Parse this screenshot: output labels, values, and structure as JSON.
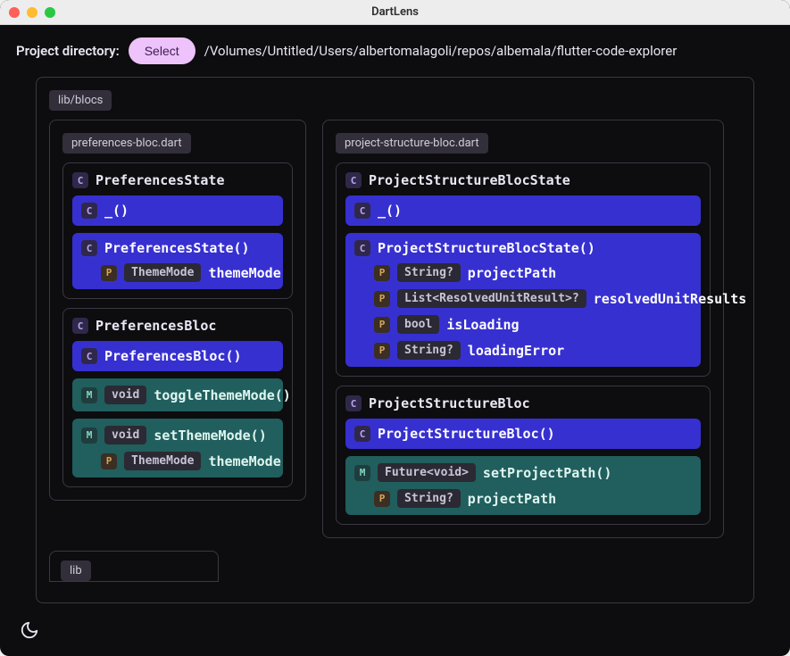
{
  "window": {
    "title": "DartLens"
  },
  "toolbar": {
    "label": "Project directory:",
    "select_label": "Select",
    "path": "/Volumes/Untitled/Users/albertomalagoli/repos/albemala/flutter-code-explorer"
  },
  "badges": {
    "c": "C",
    "m": "M",
    "p": "P"
  },
  "folders": [
    {
      "name": "lib/blocs"
    },
    {
      "name": "lib"
    }
  ],
  "files": [
    {
      "name": "preferences-bloc.dart",
      "classes": [
        {
          "name": "PreferencesState",
          "ctors": [
            {
              "name": "_()",
              "style": "indigo",
              "params": []
            },
            {
              "name": "PreferencesState()",
              "style": "indigo",
              "params": [
                {
                  "type": "ThemeMode",
                  "name": "themeMode"
                }
              ]
            }
          ],
          "methods": []
        },
        {
          "name": "PreferencesBloc",
          "ctors": [
            {
              "name": "PreferencesBloc()",
              "style": "indigo",
              "params": []
            }
          ],
          "methods": [
            {
              "name": "toggleThemeMode()",
              "style": "teal",
              "ret": "void",
              "params": []
            },
            {
              "name": "setThemeMode()",
              "style": "teal",
              "ret": "void",
              "params": [
                {
                  "type": "ThemeMode",
                  "name": "themeMode"
                }
              ]
            }
          ]
        }
      ]
    },
    {
      "name": "project-structure-bloc.dart",
      "classes": [
        {
          "name": "ProjectStructureBlocState",
          "ctors": [
            {
              "name": "_()",
              "style": "indigo",
              "params": []
            },
            {
              "name": "ProjectStructureBlocState()",
              "style": "indigo",
              "params": [
                {
                  "type": "String?",
                  "name": "projectPath"
                },
                {
                  "type": "List<ResolvedUnitResult>?",
                  "name": "resolvedUnitResults"
                },
                {
                  "type": "bool",
                  "name": "isLoading"
                },
                {
                  "type": "String?",
                  "name": "loadingError"
                }
              ]
            }
          ],
          "methods": []
        },
        {
          "name": "ProjectStructureBloc",
          "ctors": [
            {
              "name": "ProjectStructureBloc()",
              "style": "indigo",
              "params": []
            }
          ],
          "methods": [
            {
              "name": "setProjectPath()",
              "style": "teal",
              "ret": "Future<void>",
              "params": [
                {
                  "type": "String?",
                  "name": "projectPath"
                }
              ]
            }
          ]
        }
      ]
    }
  ],
  "theme": {
    "accent_indigo": "#3730d0",
    "accent_teal": "#215e5e"
  }
}
